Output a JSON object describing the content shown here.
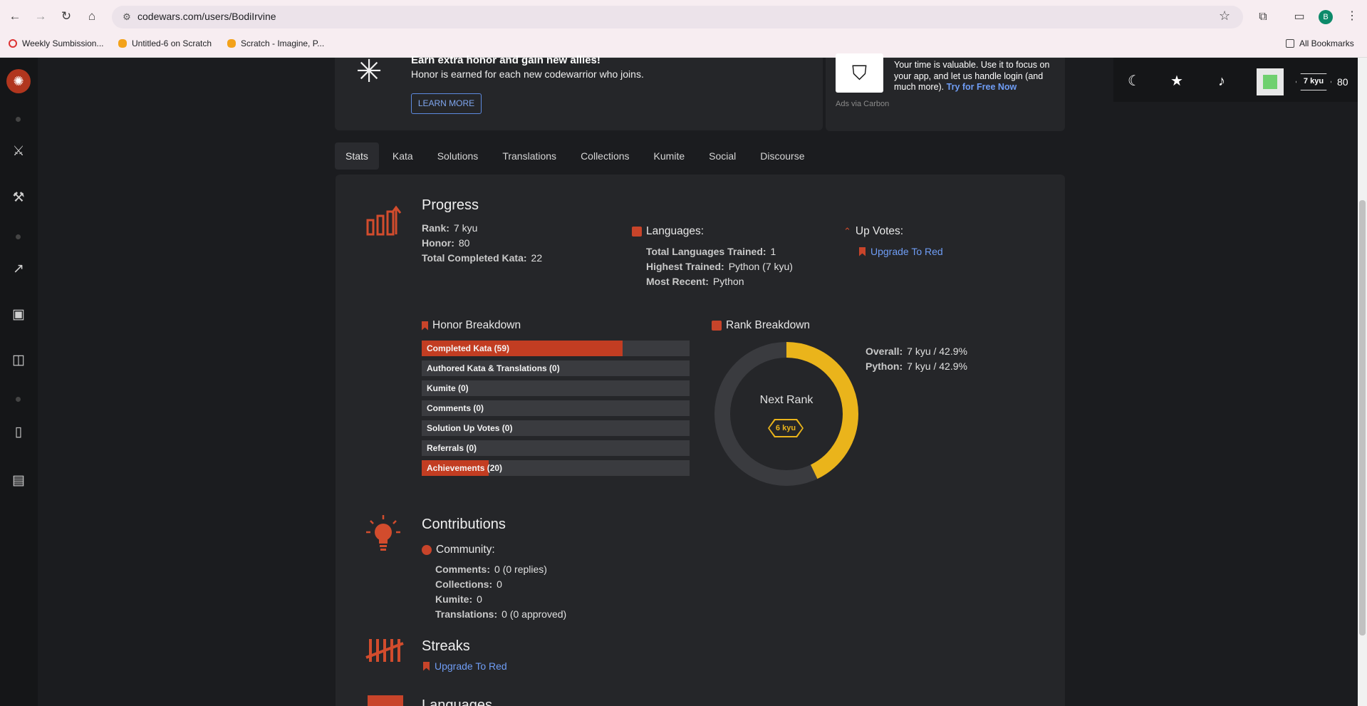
{
  "browser": {
    "url": "codewars.com/users/BodiIrvine",
    "profile_initial": "B",
    "bookmarks": [
      {
        "label": "Weekly Sumbission..."
      },
      {
        "label": "Untitled-6 on Scratch"
      },
      {
        "label": "Scratch - Imagine, P..."
      }
    ],
    "all_bookmarks": "All Bookmarks"
  },
  "banner": {
    "title": "Earn extra honor and gain new allies!",
    "subtitle": "Honor is earned for each new codewarrior who joins.",
    "button": "LEARN MORE"
  },
  "ad": {
    "text": "Your time is valuable. Use it to focus on your app, and let us handle login (and much more).",
    "link": "Try for Free Now",
    "via": "Ads via Carbon"
  },
  "topbar": {
    "rank": "7 kyu",
    "honor": "80"
  },
  "tabs": [
    "Stats",
    "Kata",
    "Solutions",
    "Translations",
    "Collections",
    "Kumite",
    "Social",
    "Discourse"
  ],
  "progress": {
    "title": "Progress",
    "rank_label": "Rank:",
    "rank": "7 kyu",
    "honor_label": "Honor:",
    "honor": "80",
    "kata_label": "Total Completed Kata:",
    "kata": "22"
  },
  "languages": {
    "title": "Languages:",
    "trained_label": "Total Languages Trained:",
    "trained": "1",
    "highest_label": "Highest Trained:",
    "highest": "Python (7 kyu)",
    "recent_label": "Most Recent:",
    "recent": "Python"
  },
  "upvotes": {
    "title": "Up Votes:",
    "link": "Upgrade To Red"
  },
  "honor_breakdown": {
    "title": "Honor Breakdown",
    "bars": [
      {
        "label": "Completed Kata (59)",
        "fraction": 0.75
      },
      {
        "label": "Authored Kata & Translations (0)",
        "fraction": 0
      },
      {
        "label": "Kumite (0)",
        "fraction": 0
      },
      {
        "label": "Comments (0)",
        "fraction": 0
      },
      {
        "label": "Solution Up Votes (0)",
        "fraction": 0
      },
      {
        "label": "Referrals (0)",
        "fraction": 0
      },
      {
        "label": "Achievements (20)",
        "fraction": 0.25
      }
    ]
  },
  "rank_breakdown": {
    "title": "Rank Breakdown",
    "progress_fraction": 0.429,
    "next_rank_label": "Next Rank",
    "next_rank": "6 kyu",
    "overall_label": "Overall:",
    "overall": "7 kyu / 42.9%",
    "python_label": "Python:",
    "python": "7 kyu / 42.9%",
    "ring_color": "#eab41b",
    "track_color": "#3a3b3f"
  },
  "contributions": {
    "title": "Contributions",
    "community_title": "Community:",
    "comments_label": "Comments:",
    "comments": "0 (0 replies)",
    "collections_label": "Collections:",
    "collections": "0",
    "kumite_label": "Kumite:",
    "kumite": "0",
    "translations_label": "Translations:",
    "translations": "0 (0 approved)"
  },
  "streaks": {
    "title": "Streaks",
    "link": "Upgrade To Red"
  },
  "languages_section": {
    "title": "Languages"
  }
}
